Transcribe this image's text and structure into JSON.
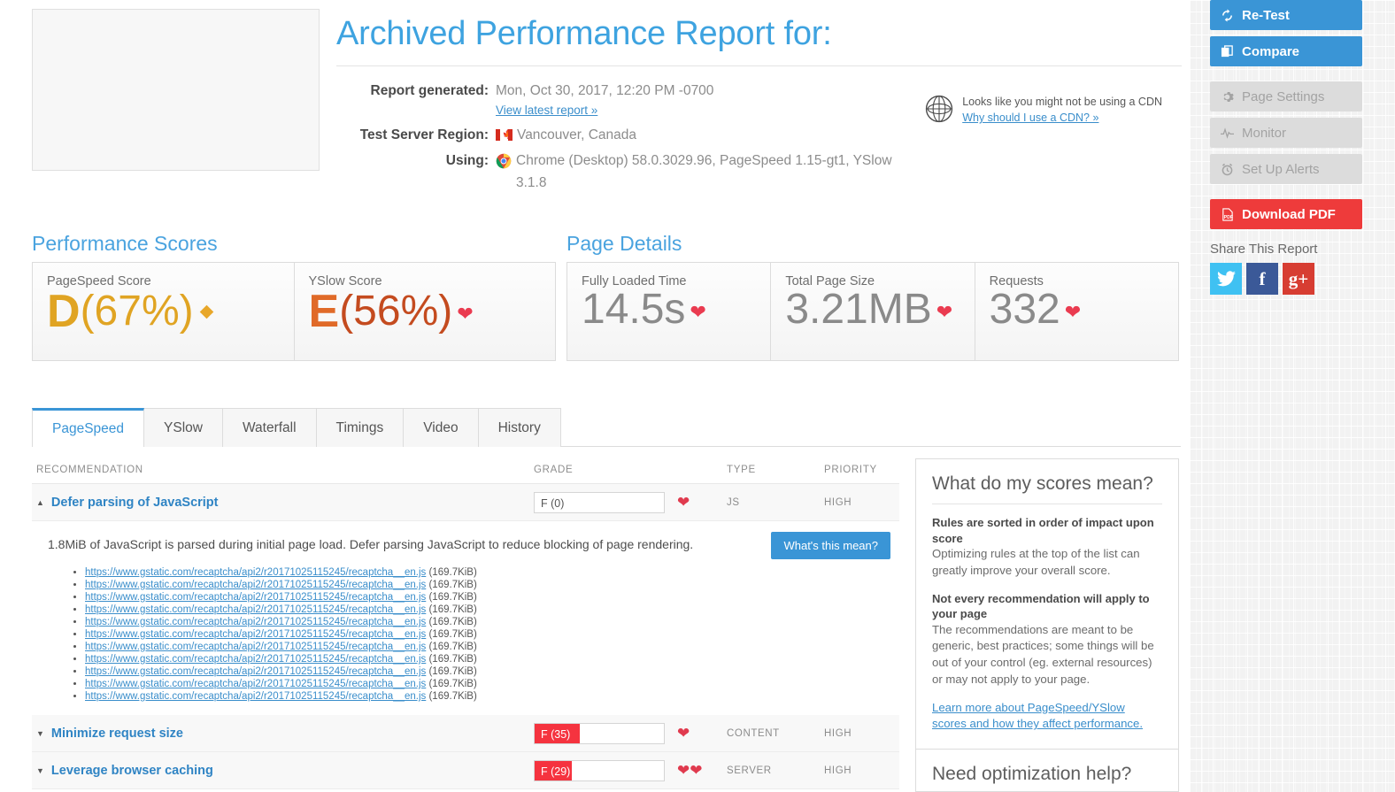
{
  "header": {
    "title": "Archived Performance Report for:",
    "meta": [
      {
        "label": "Report generated:",
        "value": "Mon, Oct 30, 2017, 12:20 PM -0700",
        "sublink": "View latest report »"
      },
      {
        "label": "Test Server Region:",
        "value": "Vancouver, Canada",
        "icon": "canada-flag-icon"
      },
      {
        "label": "Using:",
        "value": "Chrome (Desktop) 58.0.3029.96, PageSpeed 1.15-gt1, YSlow 3.1.8",
        "icon": "chrome-icon"
      }
    ],
    "cdn": {
      "icon": "globe-icon",
      "text": "Looks like you might not be using a CDN",
      "link": "Why should I use a CDN? »"
    }
  },
  "scores": {
    "performance_title": "Performance Scores",
    "page_details_title": "Page Details",
    "performance_cards": [
      {
        "label": "PageSpeed Score",
        "grade": "D",
        "pct": "(67%)",
        "marker": "diamond",
        "color": "#e0a423"
      },
      {
        "label": "YSlow Score",
        "grade": "E",
        "pct": "(56%)",
        "marker": "caret-down",
        "color": "#c44b1f"
      }
    ],
    "page_detail_cards": [
      {
        "label": "Fully Loaded Time",
        "value": "14.5s",
        "marker": "caret-down"
      },
      {
        "label": "Total Page Size",
        "value": "3.21MB",
        "marker": "caret-down"
      },
      {
        "label": "Requests",
        "value": "332",
        "marker": "caret-down"
      }
    ]
  },
  "tabs": [
    {
      "label": "PageSpeed",
      "active": true
    },
    {
      "label": "YSlow",
      "active": false
    },
    {
      "label": "Waterfall",
      "active": false
    },
    {
      "label": "Timings",
      "active": false
    },
    {
      "label": "Video",
      "active": false
    },
    {
      "label": "History",
      "active": false
    }
  ],
  "table": {
    "columns": [
      "RECOMMENDATION",
      "GRADE",
      "TYPE",
      "PRIORITY"
    ],
    "rows": [
      {
        "name": "Defer parsing of JavaScript",
        "grade_text": "F (0)",
        "grade_pct": 0,
        "type": "JS",
        "priority": "HIGH",
        "expanded": true,
        "caret": "▲"
      },
      {
        "name": "Minimize request size",
        "grade_text": "F (35)",
        "grade_pct": 35,
        "type": "CONTENT",
        "priority": "HIGH",
        "expanded": false,
        "caret": "▼"
      },
      {
        "name": "Leverage browser caching",
        "grade_text": "F (29)",
        "grade_pct": 29,
        "type": "SERVER",
        "priority": "HIGH",
        "expanded": false,
        "caret": "▼"
      }
    ],
    "detail": {
      "description": "1.8MiB of JavaScript is parsed during initial page load. Defer parsing JavaScript to reduce blocking of page rendering.",
      "button": "What's this mean?",
      "url": "https://www.gstatic.com/recaptcha/api2/r20171025115245/recaptcha__en.js",
      "size": "(169.7KiB)",
      "count": 11
    }
  },
  "info_panels": [
    {
      "title": "What do my scores mean?",
      "blocks": [
        {
          "heading": "Rules are sorted in order of impact upon score",
          "body": "Optimizing rules at the top of the list can greatly improve your overall score."
        },
        {
          "heading": "Not every recommendation will apply to your page",
          "body": "The recommendations are meant to be generic, best practices; some things will be out of your control (eg. external resources) or may not apply to your page."
        }
      ],
      "link": "Learn more about PageSpeed/YSlow scores and how they affect performance."
    },
    {
      "title": "Need optimization help?"
    }
  ],
  "sidebar": {
    "buttons": [
      {
        "label": "Re-Test",
        "icon": "refresh-icon",
        "style": "blue"
      },
      {
        "label": "Compare",
        "icon": "compare-icon",
        "style": "blue"
      },
      {
        "label": "Page Settings",
        "icon": "gear-icon",
        "style": "gray"
      },
      {
        "label": "Monitor",
        "icon": "pulse-icon",
        "style": "gray"
      },
      {
        "label": "Set Up Alerts",
        "icon": "alarm-clock-icon",
        "style": "gray"
      },
      {
        "label": "Download PDF",
        "icon": "pdf-icon",
        "style": "red"
      }
    ],
    "share_title": "Share This Report",
    "socials": [
      {
        "name": "twitter-share-button",
        "glyph": "🐦"
      },
      {
        "name": "facebook-share-button",
        "glyph": "f"
      },
      {
        "name": "googleplus-share-button",
        "glyph": "g+"
      }
    ]
  }
}
